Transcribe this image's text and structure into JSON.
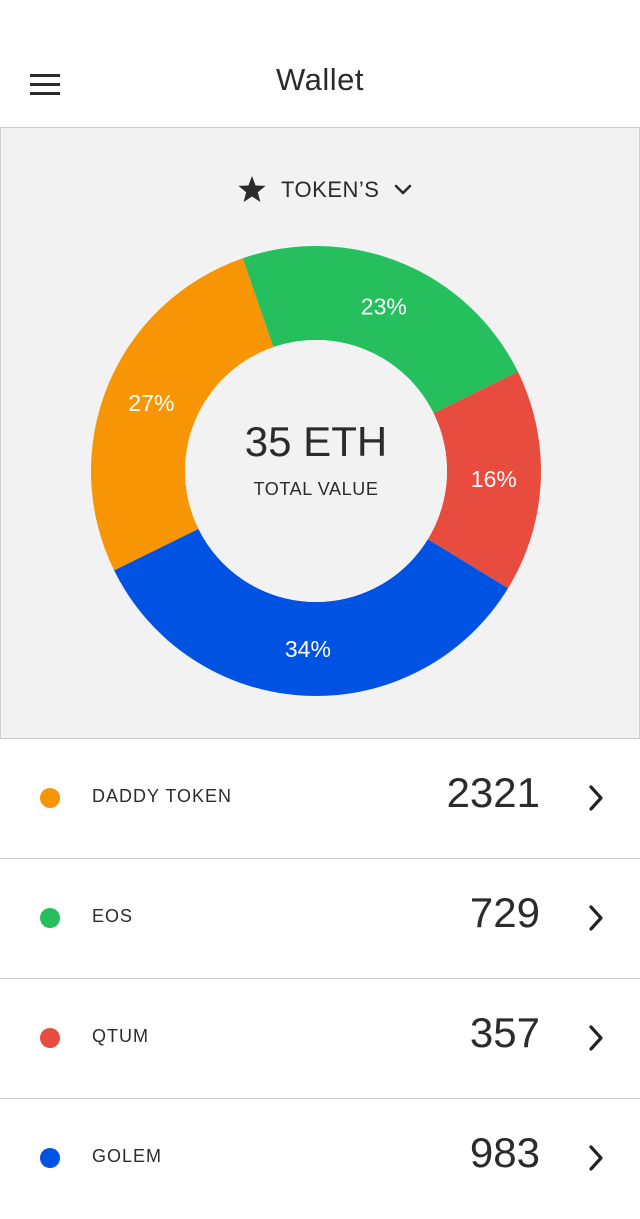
{
  "header": {
    "title": "Wallet",
    "menu_icon": "hamburger-menu-icon"
  },
  "selector": {
    "icon": "star-icon",
    "label": "TOKEN’S",
    "dropdown_icon": "chevron-down-icon"
  },
  "summary": {
    "total_value": "35 ETH",
    "total_label": "TOTAL VALUE"
  },
  "chart_data": {
    "type": "pie",
    "donut": true,
    "segments": [
      {
        "label": "23%",
        "value": 23,
        "color": "#26bf5e",
        "token": "EOS"
      },
      {
        "label": "16%",
        "value": 16,
        "color": "#e74c3f",
        "token": "QTUM"
      },
      {
        "label": "34%",
        "value": 34,
        "color": "#0052e3",
        "token": "GOLEM"
      },
      {
        "label": "27%",
        "value": 27,
        "color": "#f79504",
        "token": "DADDY TOKEN"
      }
    ]
  },
  "tokens": [
    {
      "name": "DADDY TOKEN",
      "amount": "2321",
      "color": "#f79504"
    },
    {
      "name": "EOS",
      "amount": "729",
      "color": "#26bf5e"
    },
    {
      "name": "QTUM",
      "amount": "357",
      "color": "#e74c3f"
    },
    {
      "name": "GOLEM",
      "amount": "983",
      "color": "#0052e3"
    }
  ],
  "colors": {
    "panel_background": "#f2f2f2",
    "divider": "#c9c9c9",
    "text": "#2b2b2b"
  }
}
